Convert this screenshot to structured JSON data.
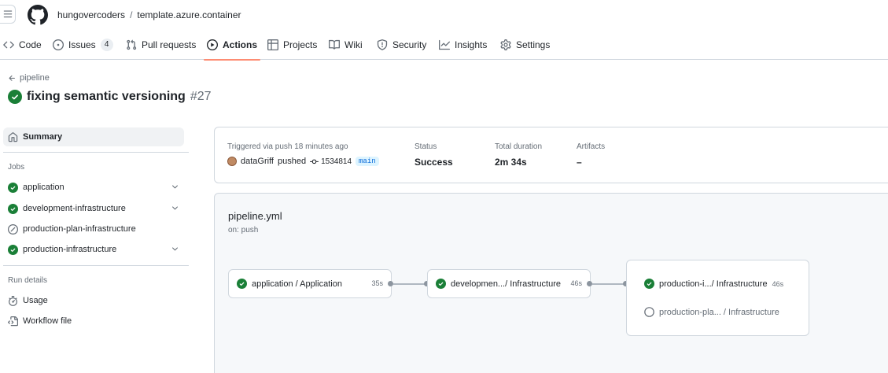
{
  "header": {
    "owner": "hungovercoders",
    "separator": "/",
    "repo": "template.azure.container"
  },
  "nav": {
    "code": "Code",
    "issues": "Issues",
    "issues_count": "4",
    "pulls": "Pull requests",
    "actions": "Actions",
    "projects": "Projects",
    "wiki": "Wiki",
    "security": "Security",
    "insights": "Insights",
    "settings": "Settings"
  },
  "run": {
    "back_label": "pipeline",
    "title": "fixing semantic versioning",
    "number": "#27"
  },
  "sidebar": {
    "summary": "Summary",
    "jobs_heading": "Jobs",
    "jobs": [
      {
        "label": "application",
        "status": "success"
      },
      {
        "label": "development-infrastructure",
        "status": "success"
      },
      {
        "label": "production-plan-infrastructure",
        "status": "skipped"
      },
      {
        "label": "production-infrastructure",
        "status": "success"
      }
    ],
    "run_details_heading": "Run details",
    "usage": "Usage",
    "workflow_file": "Workflow file"
  },
  "summary": {
    "trigger_label": "Triggered via push 18 minutes ago",
    "actor": "dataGriff",
    "action": "pushed",
    "sha": "1534814",
    "branch": "main",
    "status_label": "Status",
    "status_value": "Success",
    "duration_label": "Total duration",
    "duration_value": "2m 34s",
    "artifacts_label": "Artifacts",
    "artifacts_value": "–"
  },
  "workflow": {
    "file": "pipeline.yml",
    "trigger": "on: push",
    "jobs": {
      "app_name": "application / Application",
      "app_time": "35s",
      "dev_name": "developmen.../ Infrastructure",
      "dev_time": "46s",
      "prod_name": "production-i.../ Infrastructure",
      "prod_time": "46s",
      "plan_name": "production-pla...  / Infrastructure"
    }
  },
  "colors": {
    "success": "#1a7f37",
    "accent_underline": "#fd8c73",
    "muted": "#656d76"
  }
}
